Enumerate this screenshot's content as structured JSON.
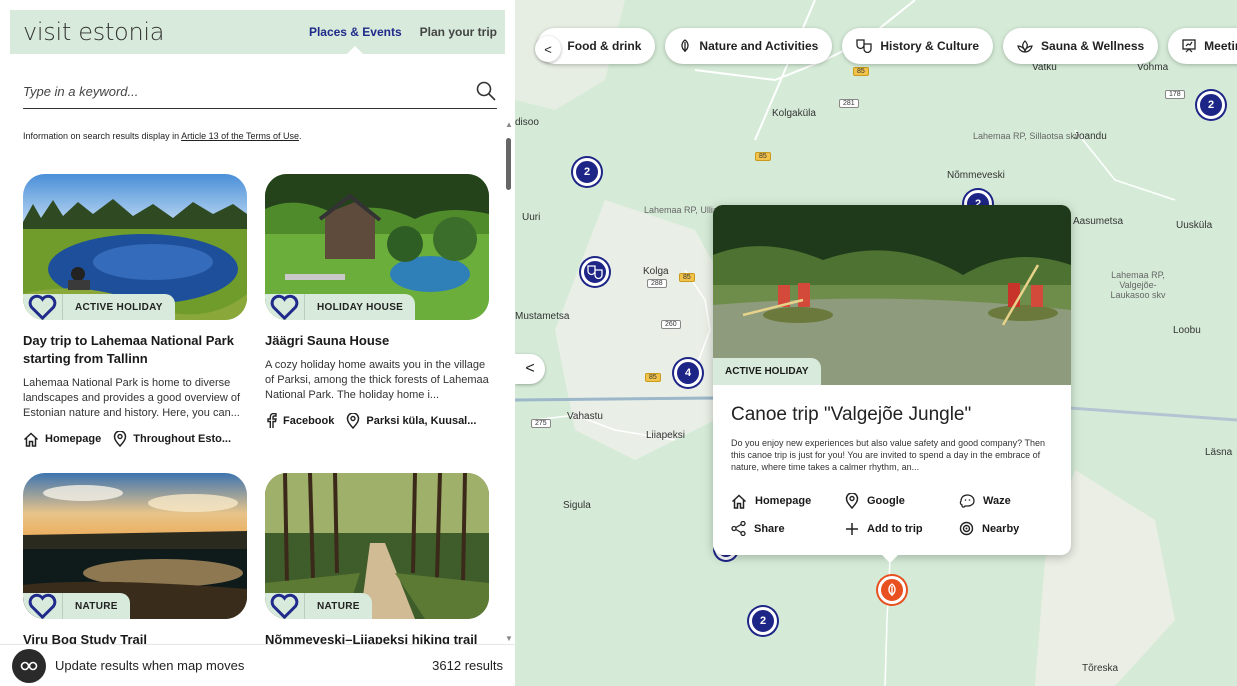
{
  "header": {
    "logo": "visit estonia",
    "nav": [
      "Places & Events",
      "Plan your trip"
    ]
  },
  "search": {
    "placeholder": "Type in a keyword..."
  },
  "info": {
    "text": "Information on search results display in ",
    "link": "Article 13 of the Terms of Use",
    "end": "."
  },
  "cards": [
    {
      "badge": "ACTIVE HOLIDAY",
      "title": "Day trip to Lahemaa National Park starting from Tallinn",
      "desc": "Lahemaa National Park is home to diverse landscapes and provides a good overview of Estonian nature and history. Here, you can...",
      "link1": "Homepage",
      "link2": "Throughout Esto..."
    },
    {
      "badge": "HOLIDAY HOUSE",
      "title": "Jäägri Sauna House",
      "desc": "A cozy holiday home awaits you in the village of Parksi, among the thick forests of Lahemaa National Park. The holiday home i...",
      "link1": "Facebook",
      "link2": "Parksi küla, Kuusal..."
    },
    {
      "badge": "NATURE",
      "title": "Viru Bog Study Trail"
    },
    {
      "badge": "NATURE",
      "title": "Nõmmeveski–Liiapeksi hiking trail"
    }
  ],
  "footer": {
    "label": "Update results when map moves",
    "count": "3612 results"
  },
  "map": {
    "chips": [
      "Food & drink",
      "Nature and Activities",
      "History & Culture",
      "Sauna & Wellness",
      "Meeting venues"
    ],
    "places": [
      "Kolgaküla",
      "Nõmmeveski",
      "Joandu",
      "Aasumetsa",
      "Uuskülа",
      "Loobu",
      "Uuri",
      "Kolga",
      "Mustametsa",
      "Vahastu",
      "Liiapeksi",
      "Sigula",
      "Läsna",
      "Tõreska",
      "Vatku",
      "Vohma",
      "disoo"
    ],
    "small_places": [
      "Lahemaa RP, Sillaotsa skv",
      "Lahemaa RP, Ulliallika skv",
      "Lahemaa RP, Valgejõe-Laukasoo skv"
    ],
    "clusters": [
      "2",
      "2",
      "4",
      "2",
      "2"
    ],
    "road_numbers": [
      "85",
      "281",
      "85",
      "178",
      "85",
      "288",
      "260",
      "85",
      "275"
    ]
  },
  "popup": {
    "badge": "ACTIVE HOLIDAY",
    "title": "Canoe trip \"Valgejõe Jungle\"",
    "desc": "Do you enjoy new experiences but also value safety and good company? Then this canoe trip is just for you! You are invited to spend a day in the embrace of nature, where time takes a calmer rhythm, an...",
    "actions": [
      "Homepage",
      "Google",
      "Waze",
      "Share",
      "Add to trip",
      "Nearby"
    ]
  },
  "colors": {
    "accent": "#1f2a8a",
    "badge_bg": "#d7eadb",
    "cluster": "#1d2587",
    "pin": "#e8501f"
  }
}
